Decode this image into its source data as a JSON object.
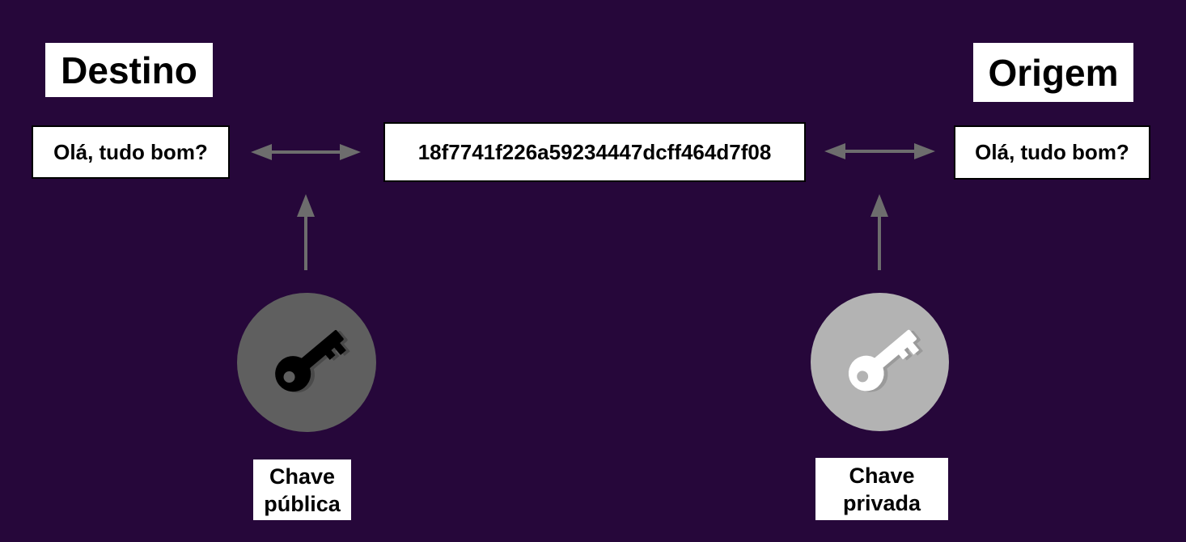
{
  "destination": {
    "title": "Destino",
    "message": "Olá, tudo bom?"
  },
  "origin": {
    "title": "Origem",
    "message": "Olá, tudo bom?"
  },
  "ciphertext": "18f7741f226a59234447dcff464d7f08",
  "public_key": {
    "label_line1": "Chave",
    "label_line2": "pública",
    "icon": "key-icon",
    "circle_color": "#5f5f5f",
    "key_color": "#000000"
  },
  "private_key": {
    "label_line1": "Chave",
    "label_line2": "privada",
    "icon": "key-icon",
    "circle_color": "#b3b3b3",
    "key_color": "#ffffff"
  },
  "colors": {
    "background": "#26073a",
    "arrow": "#6d6d6d"
  }
}
